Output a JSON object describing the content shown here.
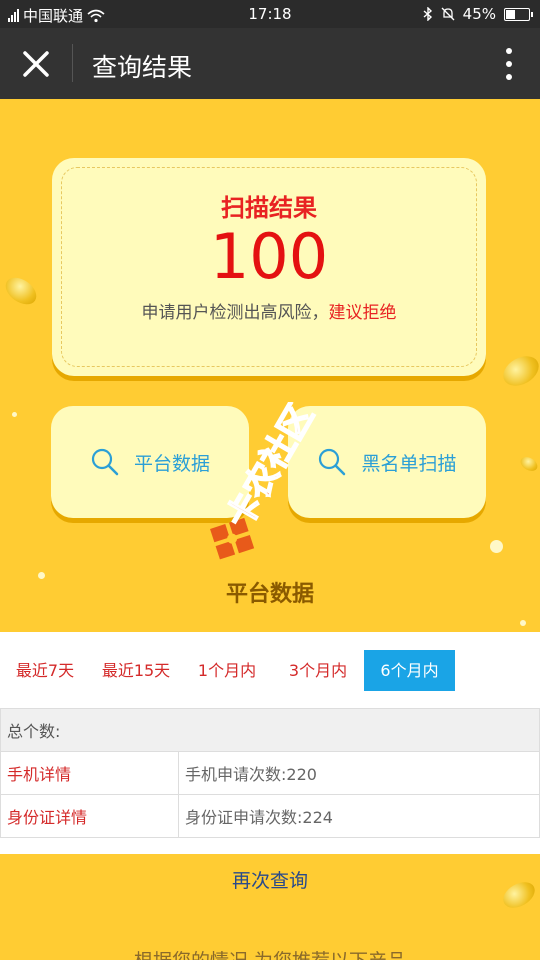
{
  "status_bar": {
    "carrier": "中国联通",
    "time": "17:18",
    "battery": "45%",
    "battery_level": 0.45
  },
  "nav": {
    "title": "查询结果"
  },
  "result": {
    "title": "扫描结果",
    "score": "100",
    "desc": "申请用户检测出高风险，",
    "advice": "建议拒绝"
  },
  "actions": {
    "platform": "平台数据",
    "blacklist": "黑名单扫描"
  },
  "watermark": {
    "text": "卡农社区"
  },
  "section": {
    "title": "平台数据"
  },
  "tabs": [
    {
      "label": "最近7天",
      "active": false
    },
    {
      "label": "最近15天",
      "active": false
    },
    {
      "label": "1个月内",
      "active": false
    },
    {
      "label": "3个月内",
      "active": false
    },
    {
      "label": "6个月内",
      "active": true
    }
  ],
  "table": {
    "header": "总个数:",
    "rows": [
      {
        "label": "手机详情",
        "value": "手机申请次数:220"
      },
      {
        "label": "身份证详情",
        "value": "身份证申请次数:224"
      }
    ]
  },
  "requery": "再次查询",
  "bottom_text": "根据您的情况,为您推荐以下产品"
}
